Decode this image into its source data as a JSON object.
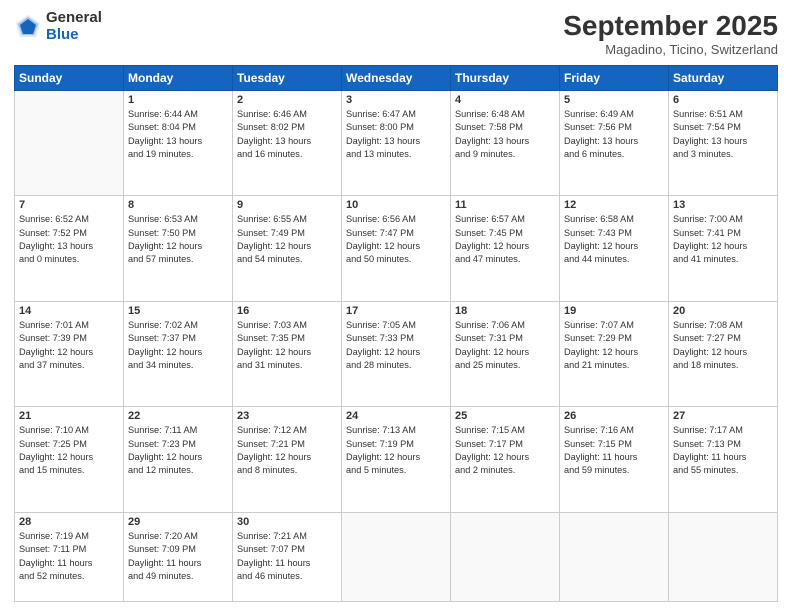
{
  "logo": {
    "general": "General",
    "blue": "Blue"
  },
  "title": "September 2025",
  "location": "Magadino, Ticino, Switzerland",
  "days_header": [
    "Sunday",
    "Monday",
    "Tuesday",
    "Wednesday",
    "Thursday",
    "Friday",
    "Saturday"
  ],
  "weeks": [
    [
      {
        "day": "",
        "details": []
      },
      {
        "day": "1",
        "details": [
          "Sunrise: 6:44 AM",
          "Sunset: 8:04 PM",
          "Daylight: 13 hours",
          "and 19 minutes."
        ]
      },
      {
        "day": "2",
        "details": [
          "Sunrise: 6:46 AM",
          "Sunset: 8:02 PM",
          "Daylight: 13 hours",
          "and 16 minutes."
        ]
      },
      {
        "day": "3",
        "details": [
          "Sunrise: 6:47 AM",
          "Sunset: 8:00 PM",
          "Daylight: 13 hours",
          "and 13 minutes."
        ]
      },
      {
        "day": "4",
        "details": [
          "Sunrise: 6:48 AM",
          "Sunset: 7:58 PM",
          "Daylight: 13 hours",
          "and 9 minutes."
        ]
      },
      {
        "day": "5",
        "details": [
          "Sunrise: 6:49 AM",
          "Sunset: 7:56 PM",
          "Daylight: 13 hours",
          "and 6 minutes."
        ]
      },
      {
        "day": "6",
        "details": [
          "Sunrise: 6:51 AM",
          "Sunset: 7:54 PM",
          "Daylight: 13 hours",
          "and 3 minutes."
        ]
      }
    ],
    [
      {
        "day": "7",
        "details": [
          "Sunrise: 6:52 AM",
          "Sunset: 7:52 PM",
          "Daylight: 13 hours",
          "and 0 minutes."
        ]
      },
      {
        "day": "8",
        "details": [
          "Sunrise: 6:53 AM",
          "Sunset: 7:50 PM",
          "Daylight: 12 hours",
          "and 57 minutes."
        ]
      },
      {
        "day": "9",
        "details": [
          "Sunrise: 6:55 AM",
          "Sunset: 7:49 PM",
          "Daylight: 12 hours",
          "and 54 minutes."
        ]
      },
      {
        "day": "10",
        "details": [
          "Sunrise: 6:56 AM",
          "Sunset: 7:47 PM",
          "Daylight: 12 hours",
          "and 50 minutes."
        ]
      },
      {
        "day": "11",
        "details": [
          "Sunrise: 6:57 AM",
          "Sunset: 7:45 PM",
          "Daylight: 12 hours",
          "and 47 minutes."
        ]
      },
      {
        "day": "12",
        "details": [
          "Sunrise: 6:58 AM",
          "Sunset: 7:43 PM",
          "Daylight: 12 hours",
          "and 44 minutes."
        ]
      },
      {
        "day": "13",
        "details": [
          "Sunrise: 7:00 AM",
          "Sunset: 7:41 PM",
          "Daylight: 12 hours",
          "and 41 minutes."
        ]
      }
    ],
    [
      {
        "day": "14",
        "details": [
          "Sunrise: 7:01 AM",
          "Sunset: 7:39 PM",
          "Daylight: 12 hours",
          "and 37 minutes."
        ]
      },
      {
        "day": "15",
        "details": [
          "Sunrise: 7:02 AM",
          "Sunset: 7:37 PM",
          "Daylight: 12 hours",
          "and 34 minutes."
        ]
      },
      {
        "day": "16",
        "details": [
          "Sunrise: 7:03 AM",
          "Sunset: 7:35 PM",
          "Daylight: 12 hours",
          "and 31 minutes."
        ]
      },
      {
        "day": "17",
        "details": [
          "Sunrise: 7:05 AM",
          "Sunset: 7:33 PM",
          "Daylight: 12 hours",
          "and 28 minutes."
        ]
      },
      {
        "day": "18",
        "details": [
          "Sunrise: 7:06 AM",
          "Sunset: 7:31 PM",
          "Daylight: 12 hours",
          "and 25 minutes."
        ]
      },
      {
        "day": "19",
        "details": [
          "Sunrise: 7:07 AM",
          "Sunset: 7:29 PM",
          "Daylight: 12 hours",
          "and 21 minutes."
        ]
      },
      {
        "day": "20",
        "details": [
          "Sunrise: 7:08 AM",
          "Sunset: 7:27 PM",
          "Daylight: 12 hours",
          "and 18 minutes."
        ]
      }
    ],
    [
      {
        "day": "21",
        "details": [
          "Sunrise: 7:10 AM",
          "Sunset: 7:25 PM",
          "Daylight: 12 hours",
          "and 15 minutes."
        ]
      },
      {
        "day": "22",
        "details": [
          "Sunrise: 7:11 AM",
          "Sunset: 7:23 PM",
          "Daylight: 12 hours",
          "and 12 minutes."
        ]
      },
      {
        "day": "23",
        "details": [
          "Sunrise: 7:12 AM",
          "Sunset: 7:21 PM",
          "Daylight: 12 hours",
          "and 8 minutes."
        ]
      },
      {
        "day": "24",
        "details": [
          "Sunrise: 7:13 AM",
          "Sunset: 7:19 PM",
          "Daylight: 12 hours",
          "and 5 minutes."
        ]
      },
      {
        "day": "25",
        "details": [
          "Sunrise: 7:15 AM",
          "Sunset: 7:17 PM",
          "Daylight: 12 hours",
          "and 2 minutes."
        ]
      },
      {
        "day": "26",
        "details": [
          "Sunrise: 7:16 AM",
          "Sunset: 7:15 PM",
          "Daylight: 11 hours",
          "and 59 minutes."
        ]
      },
      {
        "day": "27",
        "details": [
          "Sunrise: 7:17 AM",
          "Sunset: 7:13 PM",
          "Daylight: 11 hours",
          "and 55 minutes."
        ]
      }
    ],
    [
      {
        "day": "28",
        "details": [
          "Sunrise: 7:19 AM",
          "Sunset: 7:11 PM",
          "Daylight: 11 hours",
          "and 52 minutes."
        ]
      },
      {
        "day": "29",
        "details": [
          "Sunrise: 7:20 AM",
          "Sunset: 7:09 PM",
          "Daylight: 11 hours",
          "and 49 minutes."
        ]
      },
      {
        "day": "30",
        "details": [
          "Sunrise: 7:21 AM",
          "Sunset: 7:07 PM",
          "Daylight: 11 hours",
          "and 46 minutes."
        ]
      },
      {
        "day": "",
        "details": []
      },
      {
        "day": "",
        "details": []
      },
      {
        "day": "",
        "details": []
      },
      {
        "day": "",
        "details": []
      }
    ]
  ]
}
